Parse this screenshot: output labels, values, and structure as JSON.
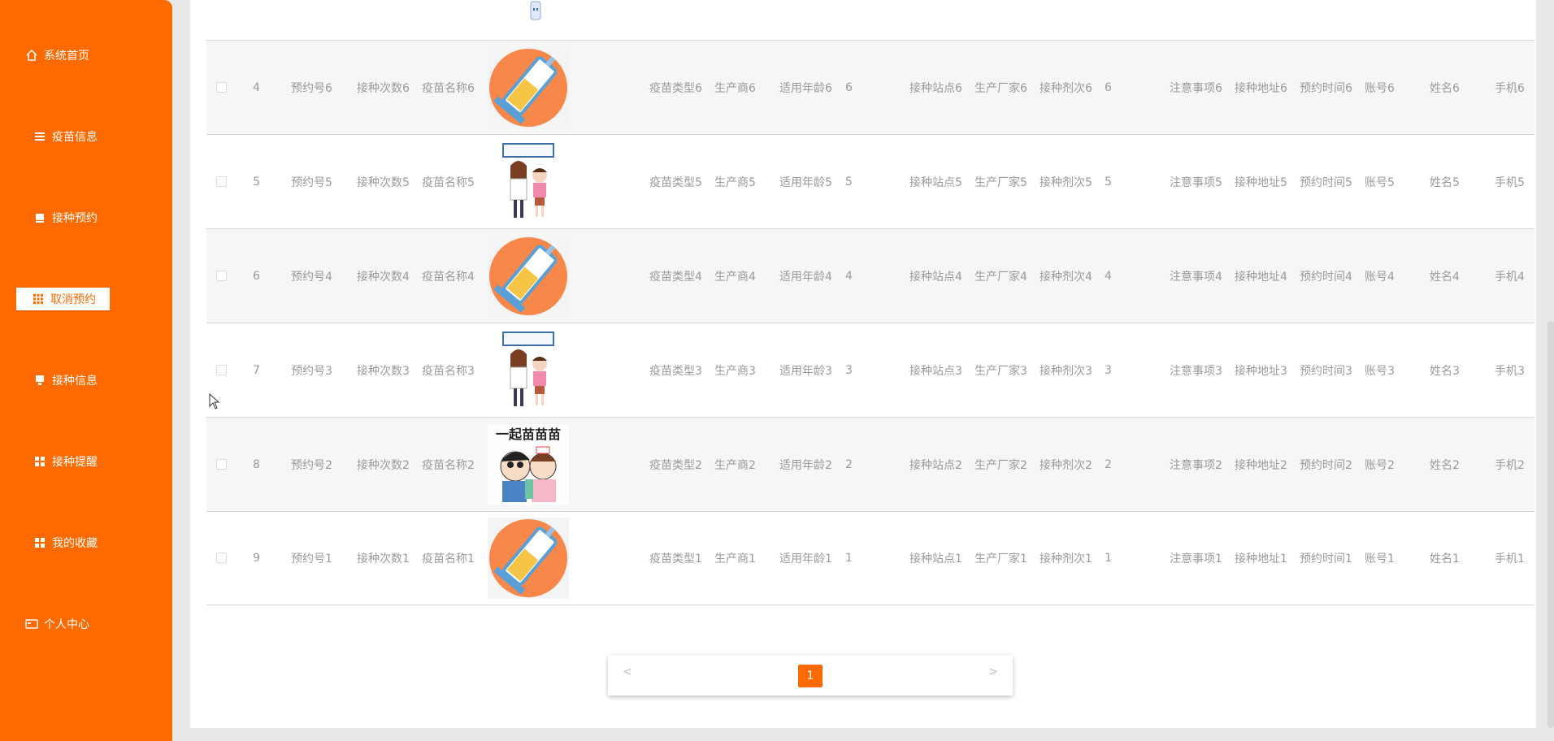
{
  "colors": {
    "accent": "#ff6a00",
    "sidebar_text": "#ffffff",
    "row_alt": "#f6f6f6"
  },
  "sidebar": {
    "items": [
      {
        "label": "系统首页",
        "icon": "home-icon",
        "active": false
      },
      {
        "label": "疫苗信息",
        "icon": "list-icon",
        "active": false
      },
      {
        "label": "接种预约",
        "icon": "calendar-icon",
        "active": false
      },
      {
        "label": "取消预约",
        "icon": "grid-icon",
        "active": true
      },
      {
        "label": "接种信息",
        "icon": "clipboard-icon",
        "active": false
      },
      {
        "label": "接种提醒",
        "icon": "grid-icon",
        "active": false
      },
      {
        "label": "我的收藏",
        "icon": "grid-icon",
        "active": false
      },
      {
        "label": "个人中心",
        "icon": "id-card-icon",
        "active": false
      }
    ]
  },
  "table": {
    "rows": [
      {
        "index": "4",
        "booking_no": "预约号6",
        "dose_count": "接种次数6",
        "vaccine_name": "疫苗名称6",
        "image": "syringe-image",
        "vaccine_type": "疫苗类型6",
        "maker": "生产商6",
        "age": "适用年龄6",
        "num": "6",
        "site": "接种站点6",
        "factory": "生产厂家6",
        "batch_label": "接种剂次6",
        "batch": "6",
        "notes": "注意事项6",
        "address": "接种地址6",
        "time": "预约时间6",
        "account": "账号6",
        "name": "姓名6",
        "phone": "手机6"
      },
      {
        "index": "5",
        "booking_no": "预约号5",
        "dose_count": "接种次数5",
        "vaccine_name": "疫苗名称5",
        "image": "vaccination-cartoon-image",
        "vaccine_type": "疫苗类型5",
        "maker": "生产商5",
        "age": "适用年龄5",
        "num": "5",
        "site": "接种站点5",
        "factory": "生产厂家5",
        "batch_label": "接种剂次5",
        "batch": "5",
        "notes": "注意事项5",
        "address": "接种地址5",
        "time": "预约时间5",
        "account": "账号5",
        "name": "姓名5",
        "phone": "手机5"
      },
      {
        "index": "6",
        "booking_no": "预约号4",
        "dose_count": "接种次数4",
        "vaccine_name": "疫苗名称4",
        "image": "syringe-image",
        "vaccine_type": "疫苗类型4",
        "maker": "生产商4",
        "age": "适用年龄4",
        "num": "4",
        "site": "接种站点4",
        "factory": "生产厂家4",
        "batch_label": "接种剂次4",
        "batch": "4",
        "notes": "注意事项4",
        "address": "接种地址4",
        "time": "预约时间4",
        "account": "账号4",
        "name": "姓名4",
        "phone": "手机4"
      },
      {
        "index": "7",
        "booking_no": "预约号3",
        "dose_count": "接种次数3",
        "vaccine_name": "疫苗名称3",
        "image": "vaccination-cartoon-image",
        "vaccine_type": "疫苗类型3",
        "maker": "生产商3",
        "age": "适用年龄3",
        "num": "3",
        "site": "接种站点3",
        "factory": "生产厂家3",
        "batch_label": "接种剂次3",
        "batch": "3",
        "notes": "注意事项3",
        "address": "接种地址3",
        "time": "预约时间3",
        "account": "账号3",
        "name": "姓名3",
        "phone": "手机3"
      },
      {
        "index": "8",
        "booking_no": "预约号2",
        "dose_count": "接种次数2",
        "vaccine_name": "疫苗名称2",
        "image": "cartoon-kids-image",
        "vaccine_type": "疫苗类型2",
        "maker": "生产商2",
        "age": "适用年龄2",
        "num": "2",
        "site": "接种站点2",
        "factory": "生产厂家2",
        "batch_label": "接种剂次2",
        "batch": "2",
        "notes": "注意事项2",
        "address": "接种地址2",
        "time": "预约时间2",
        "account": "账号2",
        "name": "姓名2",
        "phone": "手机2"
      },
      {
        "index": "9",
        "booking_no": "预约号1",
        "dose_count": "接种次数1",
        "vaccine_name": "疫苗名称1",
        "image": "syringe-image",
        "vaccine_type": "疫苗类型1",
        "maker": "生产商1",
        "age": "适用年龄1",
        "num": "1",
        "site": "接种站点1",
        "factory": "生产厂家1",
        "batch_label": "接种剂次1",
        "batch": "1",
        "notes": "注意事项1",
        "address": "接种地址1",
        "time": "预约时间1",
        "account": "账号1",
        "name": "姓名1",
        "phone": "手机1"
      }
    ]
  },
  "pagination": {
    "prev": "<",
    "current": "1",
    "next": ">"
  }
}
